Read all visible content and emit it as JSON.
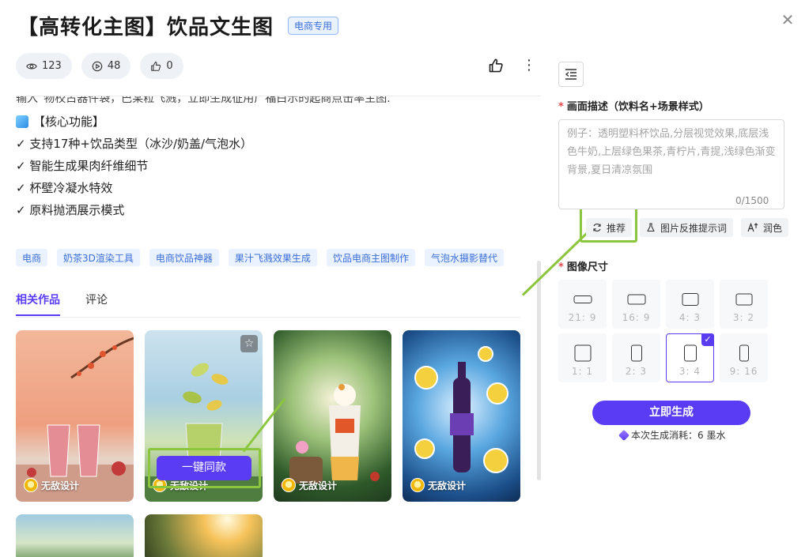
{
  "header": {
    "title": "【高转化主图】饮品文生图",
    "badge": "电商专用",
    "close_icon": "close-icon"
  },
  "stats": [
    {
      "icon": "eye-icon",
      "count": "123"
    },
    {
      "icon": "play-icon",
      "count": "48"
    },
    {
      "icon": "thumb-up-icon",
      "count": "0"
    }
  ],
  "description": {
    "clipped_line": "输入“物校占器件袋，巴某粒飞溅，立即生成征用广福白示的起商点击率主图.",
    "feature_head": "【核心功能】",
    "features": [
      "✓ 支持17种+饮品类型（冰沙/奶盖/气泡水）",
      "✓ 智能生成果肉纤维细节",
      "✓ 杯壁冷凝水特效",
      "✓ 原料抛洒展示模式"
    ]
  },
  "tags": [
    "电商",
    "奶茶3D渲染工具",
    "电商饮品神器",
    "果汁飞溅效果生成",
    "饮品电商主图制作",
    "气泡水摄影替代"
  ],
  "tabs": [
    {
      "label": "相关作品",
      "active": true
    },
    {
      "label": "评论",
      "active": false
    }
  ],
  "works": [
    {
      "author": "无敌设计"
    },
    {
      "author": "无敌设计",
      "hover_action": "一键同款"
    },
    {
      "author": "无敌设计"
    },
    {
      "author": "无敌设计"
    }
  ],
  "panel": {
    "prompt_label": "画面描述（饮料名+场景样式）",
    "prompt_value": "",
    "prompt_placeholder": "例子：透明塑料杯饮品,分层视觉效果,底层浅色牛奶,上层绿色果茶,青柠片,青提,浅绿色渐变背景,夏日清凉氛围",
    "counter": "0/1500",
    "tools": [
      {
        "label": "推荐",
        "icon": "refresh-icon"
      },
      {
        "label": "图片反推提示词",
        "icon": "flask-icon"
      },
      {
        "label": "润色",
        "icon": "text-magic-icon"
      }
    ],
    "size_label": "图像尺寸",
    "sizes": [
      {
        "label": "21: 9"
      },
      {
        "label": "16: 9"
      },
      {
        "label": "4: 3"
      },
      {
        "label": "3: 2"
      },
      {
        "label": "1: 1"
      },
      {
        "label": "2: 3"
      },
      {
        "label": "3: 4",
        "selected": true
      },
      {
        "label": "9: 16"
      }
    ],
    "generate_label": "立即生成",
    "cost_text": "本次生成消耗：6 墨水"
  },
  "colors": {
    "accent": "#5b3cf5",
    "highlight": "#8cc63f",
    "tag_text": "#3a6fd8",
    "required": "#e5484d"
  }
}
